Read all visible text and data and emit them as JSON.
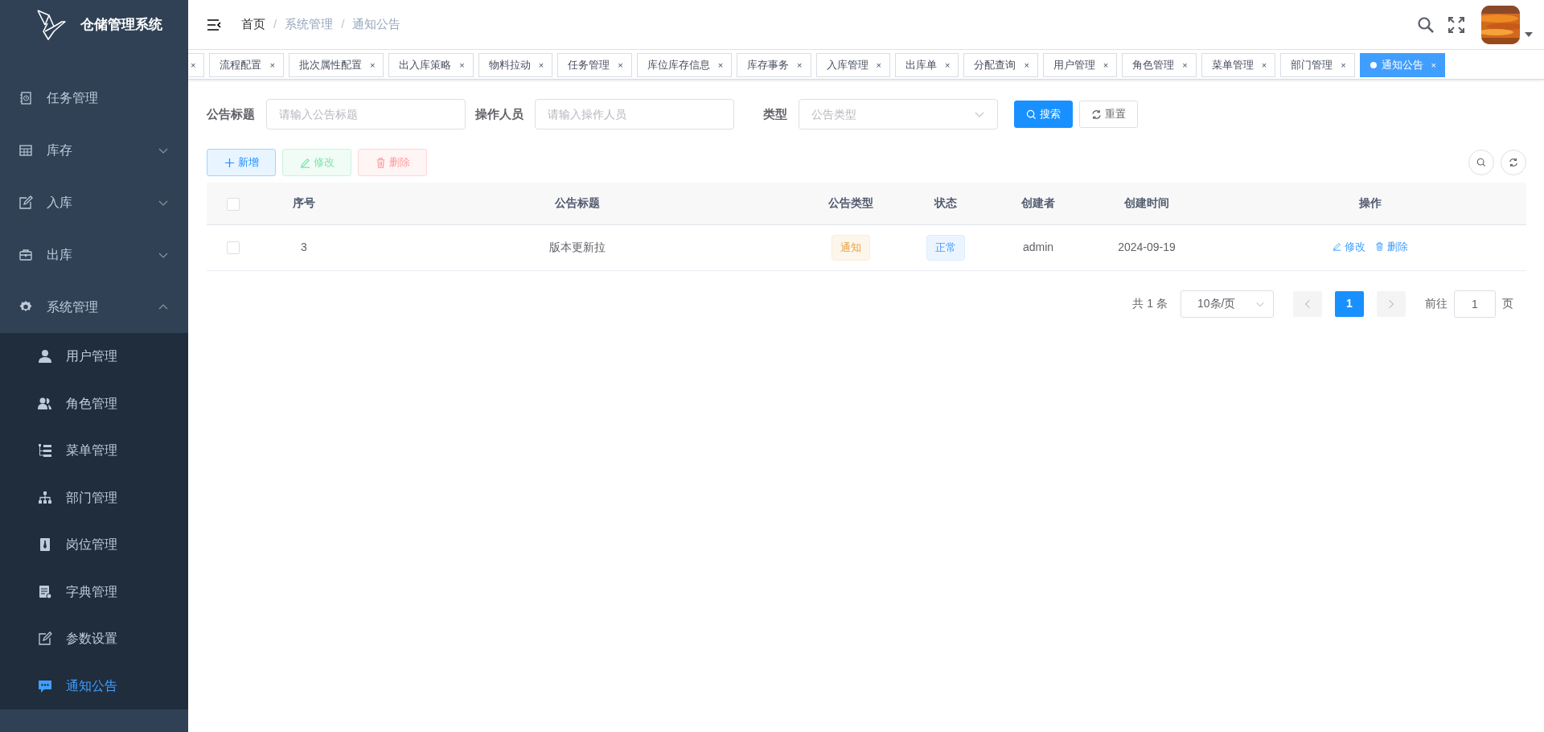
{
  "app": {
    "title": "仓储管理系统"
  },
  "sidebar": {
    "items": [
      {
        "label": "任务管理",
        "kind": "link"
      },
      {
        "label": "库存",
        "kind": "group",
        "expanded": false
      },
      {
        "label": "入库",
        "kind": "group",
        "expanded": false
      },
      {
        "label": "出库",
        "kind": "group",
        "expanded": false
      },
      {
        "label": "系统管理",
        "kind": "group",
        "expanded": true,
        "children": [
          {
            "label": "用户管理",
            "selected": false
          },
          {
            "label": "角色管理",
            "selected": false
          },
          {
            "label": "菜单管理",
            "selected": false
          },
          {
            "label": "部门管理",
            "selected": false
          },
          {
            "label": "岗位管理",
            "selected": false
          },
          {
            "label": "字典管理",
            "selected": false
          },
          {
            "label": "参数设置",
            "selected": false
          },
          {
            "label": "通知公告",
            "selected": true
          }
        ]
      }
    ]
  },
  "header": {
    "breadcrumb": [
      {
        "label": "首页",
        "current": false
      },
      {
        "label": "/",
        "kind": "sep"
      },
      {
        "label": "系统管理",
        "current": true
      },
      {
        "label": "/",
        "kind": "sep"
      },
      {
        "label": "通知公告",
        "current": true
      }
    ]
  },
  "tabs": [
    {
      "close": "×",
      "selected": false
    },
    {
      "label": "流程配置",
      "close": "×",
      "selected": false
    },
    {
      "label": "批次属性配置",
      "close": "×",
      "selected": false
    },
    {
      "label": "出入库策略",
      "close": "×",
      "selected": false
    },
    {
      "label": "物料拉动",
      "close": "×",
      "selected": false
    },
    {
      "label": "任务管理",
      "close": "×",
      "selected": false
    },
    {
      "label": "库位库存信息",
      "close": "×",
      "selected": false
    },
    {
      "label": "库存事务",
      "close": "×",
      "selected": false
    },
    {
      "label": "入库管理",
      "close": "×",
      "selected": false
    },
    {
      "label": "出库单",
      "close": "×",
      "selected": false
    },
    {
      "label": "分配查询",
      "close": "×",
      "selected": false
    },
    {
      "label": "用户管理",
      "close": "×",
      "selected": false
    },
    {
      "label": "角色管理",
      "close": "×",
      "selected": false
    },
    {
      "label": "菜单管理",
      "close": "×",
      "selected": false
    },
    {
      "label": "部门管理",
      "close": "×",
      "selected": false
    },
    {
      "label": "通知公告",
      "close": "×",
      "selected": true
    }
  ],
  "search": {
    "fields": [
      {
        "label": "公告标题",
        "placeholder": "请输入公告标题",
        "kind": "input"
      },
      {
        "label": "操作人员",
        "placeholder": "请输入操作人员",
        "kind": "input"
      },
      {
        "label": "类型",
        "placeholder": "公告类型",
        "kind": "select"
      }
    ],
    "buttons": [
      {
        "label": "搜索",
        "kind": "primary"
      },
      {
        "label": "重置",
        "kind": "default"
      }
    ]
  },
  "toolbar": {
    "buttons": [
      {
        "label": "新增",
        "kind": "add",
        "disabled": false
      },
      {
        "label": "修改",
        "kind": "edit",
        "disabled": true
      },
      {
        "label": "删除",
        "kind": "delete",
        "disabled": true
      }
    ]
  },
  "table": {
    "select_all_checked": false,
    "columns": [
      "序号",
      "公告标题",
      "公告类型",
      "状态",
      "创建者",
      "创建时间",
      "操作"
    ],
    "rows": [
      {
        "checked": false,
        "index": "3",
        "title": "版本更新拉",
        "type": {
          "label": "通知",
          "kind": "warning"
        },
        "status": {
          "label": "正常",
          "kind": "primary"
        },
        "creator": "admin",
        "created": "2024-09-19",
        "actions": [
          {
            "label": "修改",
            "kind": "edit"
          },
          {
            "label": "删除",
            "kind": "delete"
          }
        ]
      }
    ]
  },
  "pagination": {
    "total": "共 1 条",
    "page_size": "10条/页",
    "prev_disabled": true,
    "next_disabled": true,
    "pages": [
      {
        "label": "1",
        "selected": true
      }
    ],
    "goto_label": "前往",
    "goto_value": "1",
    "goto_suffix": "页"
  }
}
